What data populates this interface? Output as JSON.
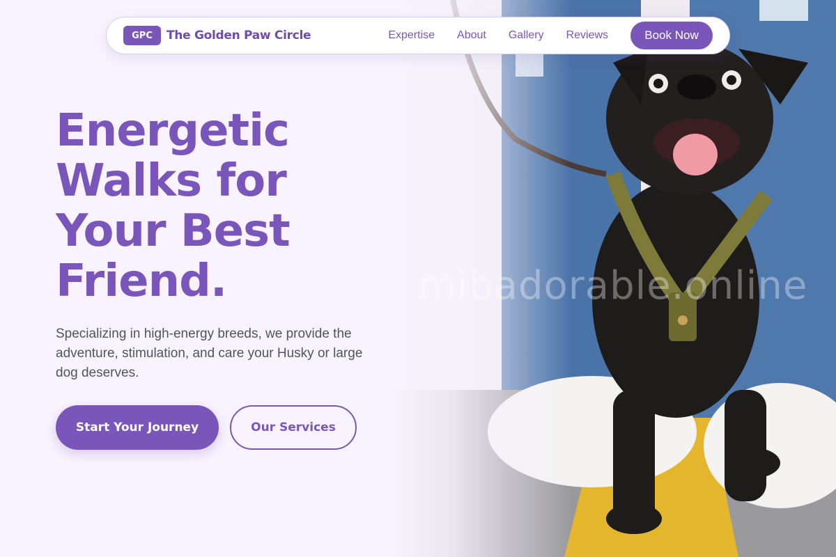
{
  "nav": {
    "badge": "GPC",
    "brand_name": "The Golden Paw Circle",
    "links": [
      "Expertise",
      "About",
      "Gallery",
      "Reviews"
    ],
    "cta": "Book Now"
  },
  "hero": {
    "headline_lines": [
      "Energetic",
      "Walks for",
      "Your Best",
      "Friend."
    ],
    "subtitle": "Specializing in high-energy breeds, we provide the adventure, stimulation, and care your Husky or large dog deserves.",
    "primary_button": "Start Your Journey",
    "secondary_button": "Our Services",
    "image_alt": "Black pug on a leash in a mustard harness standing between a person's white sneakers on a road with a yellow line",
    "watermark": "mibadorable.online"
  },
  "colors": {
    "accent": "#7a56bb",
    "background": "#f8f3fe",
    "body_text": "#4d5560"
  },
  "icons": [
    "hero-dog-photo"
  ]
}
